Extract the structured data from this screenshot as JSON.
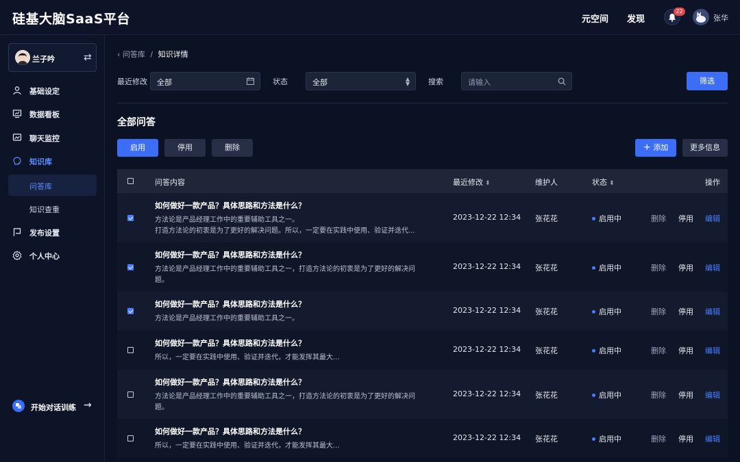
{
  "app": {
    "title": "硅基大脑SaaS平台"
  },
  "header": {
    "nav": [
      "元空间",
      "发现"
    ],
    "notification_count": "22",
    "user_name": "张华"
  },
  "sidebar": {
    "profile_name": "兰子吟",
    "items": [
      {
        "label": "基础设定",
        "icon": "user-icon"
      },
      {
        "label": "数据看板",
        "icon": "chart-icon"
      },
      {
        "label": "聊天监控",
        "icon": "monitor-icon"
      },
      {
        "label": "知识库",
        "icon": "brain-icon"
      },
      {
        "label": "问答库"
      },
      {
        "label": "知识查重"
      },
      {
        "label": "发布设置",
        "icon": "flag-icon"
      },
      {
        "label": "个人中心",
        "icon": "gear-icon"
      }
    ],
    "train_label": "开始对话训练"
  },
  "breadcrumb": {
    "parent": "问答库",
    "separator": "/",
    "current": "知识详情"
  },
  "filters": {
    "date_label": "最近修改",
    "date_value": "全部",
    "status_label": "状态",
    "status_value": "全部",
    "search_label": "搜索",
    "search_placeholder": "请输入",
    "filter_button": "筛选"
  },
  "section": {
    "title": "全部问答",
    "enable": "启用",
    "disable": "停用",
    "delete": "删除",
    "add": "添加",
    "more": "更多信息"
  },
  "table": {
    "headers": {
      "content": "问答内容",
      "modified": "最近修改",
      "maintainer": "维护人",
      "status": "状态",
      "actions": "操作"
    },
    "rows": [
      {
        "checked": true,
        "title": "如何做好一款产品？具体思路和方法是什么？",
        "desc1": "方法论是产品经理工作中的重要辅助工具之一。",
        "desc2": "打造方法论的初衷是为了更好的解决问题。所以，一定要在实践中使用、验证并迭代...",
        "date": "2023-12-22 12:34",
        "maintainer": "张花花",
        "status": "启用中",
        "del": "删除",
        "stop": "停用",
        "edit": "编辑"
      },
      {
        "checked": true,
        "title": "如何做好一款产品？具体思路和方法是什么？",
        "desc1": "方法论是产品经理工作中的重要辅助工具之一，打造方法论的初衷是为了更好的解决问",
        "desc2": "题。",
        "date": "2023-12-22 12:34",
        "maintainer": "张花花",
        "status": "启用中",
        "del": "删除",
        "stop": "停用",
        "edit": "编辑"
      },
      {
        "checked": true,
        "title": "如何做好一款产品？具体思路和方法是什么？",
        "desc1": "方法论是产品经理工作中的重要辅助工具之一。",
        "desc2": "",
        "date": "2023-12-22 12:34",
        "maintainer": "张花花",
        "status": "启用中",
        "del": "删除",
        "stop": "停用",
        "edit": "编辑"
      },
      {
        "checked": false,
        "title": "如何做好一款产品？具体思路和方法是什么？",
        "desc1": "所以，一定要在实践中使用、验证并迭代，才能发挥其最大...",
        "desc2": "",
        "date": "2023-12-22 12:34",
        "maintainer": "张花花",
        "status": "启用中",
        "del": "删除",
        "stop": "停用",
        "edit": "编辑"
      },
      {
        "checked": false,
        "title": "如何做好一款产品？具体思路和方法是什么？",
        "desc1": "方法论是产品经理工作中的重要辅助工具之一，打造方法论的初衷是为了更好的解决问",
        "desc2": "题。",
        "date": "2023-12-22 12:34",
        "maintainer": "张花花",
        "status": "启用中",
        "del": "删除",
        "stop": "停用",
        "edit": "编辑"
      },
      {
        "checked": false,
        "title": "如何做好一款产品？具体思路和方法是什么？",
        "desc1": "所以，一定要在实践中使用、验证并迭代，才能发挥其最大...",
        "desc2": "",
        "date": "2023-12-22 12:34",
        "maintainer": "张花花",
        "status": "启用中",
        "del": "删除",
        "stop": "停用",
        "edit": "编辑"
      }
    ]
  },
  "colors": {
    "accent": "#3b6ef5",
    "bg": "#0b1224",
    "panel": "#0d1428"
  }
}
